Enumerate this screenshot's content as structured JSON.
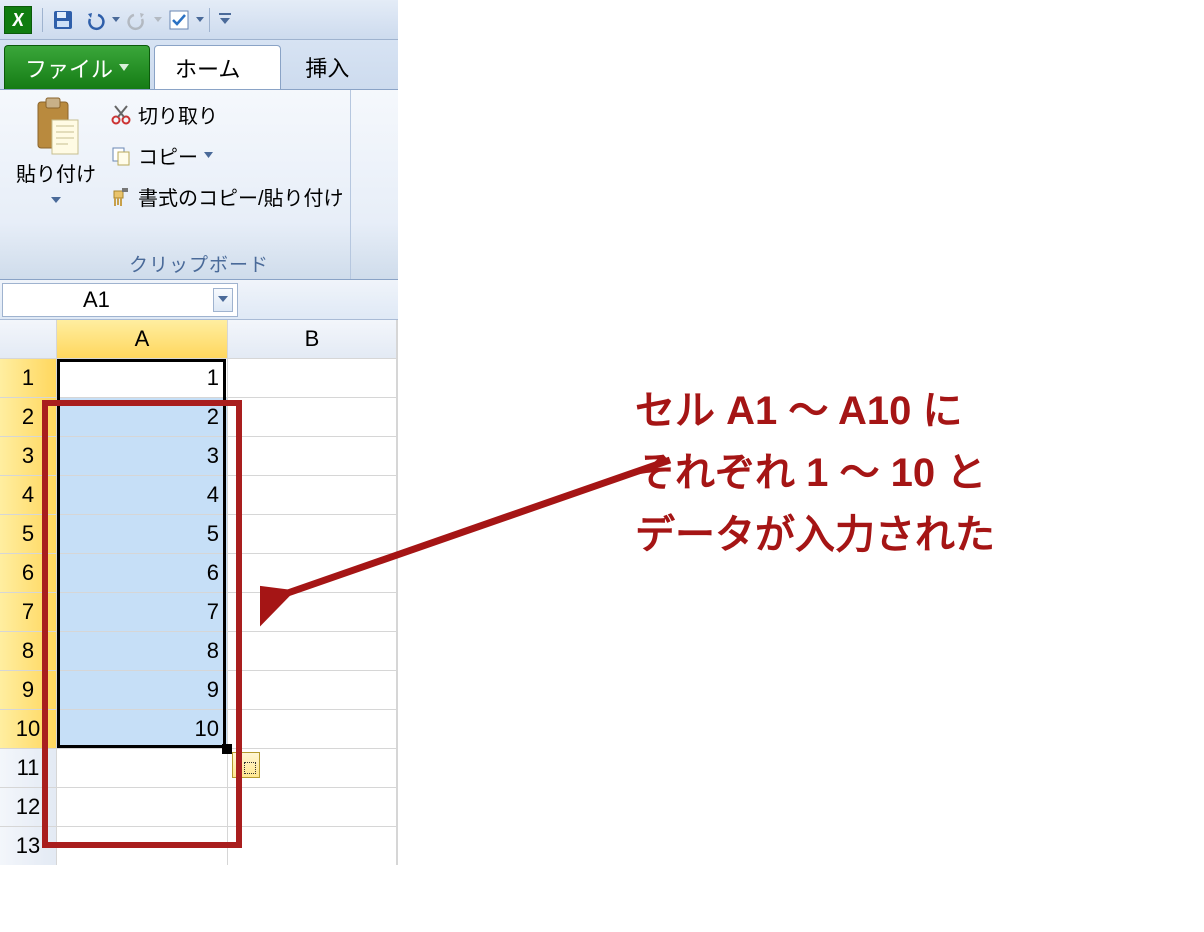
{
  "qat": {
    "excel_letter": "X"
  },
  "tabs": {
    "file": "ファイル",
    "home": "ホーム",
    "insert": "挿入"
  },
  "ribbon": {
    "paste": "貼り付け",
    "cut": "切り取り",
    "copy": "コピー",
    "format_painter": "書式のコピー/貼り付け",
    "group_label": "クリップボード"
  },
  "namebox": {
    "ref": "A1"
  },
  "grid": {
    "col_headers": [
      "A",
      "B"
    ],
    "row_headers": [
      "1",
      "2",
      "3",
      "4",
      "5",
      "6",
      "7",
      "8",
      "9",
      "10",
      "11",
      "12",
      "13"
    ],
    "values_A": [
      "1",
      "2",
      "3",
      "4",
      "5",
      "6",
      "7",
      "8",
      "9",
      "10",
      "",
      "",
      ""
    ]
  },
  "annotation": {
    "line1": "セル A1 ～ A10 に",
    "line2": "それぞれ 1 ～ 10 と",
    "line3": "データが入力された"
  }
}
